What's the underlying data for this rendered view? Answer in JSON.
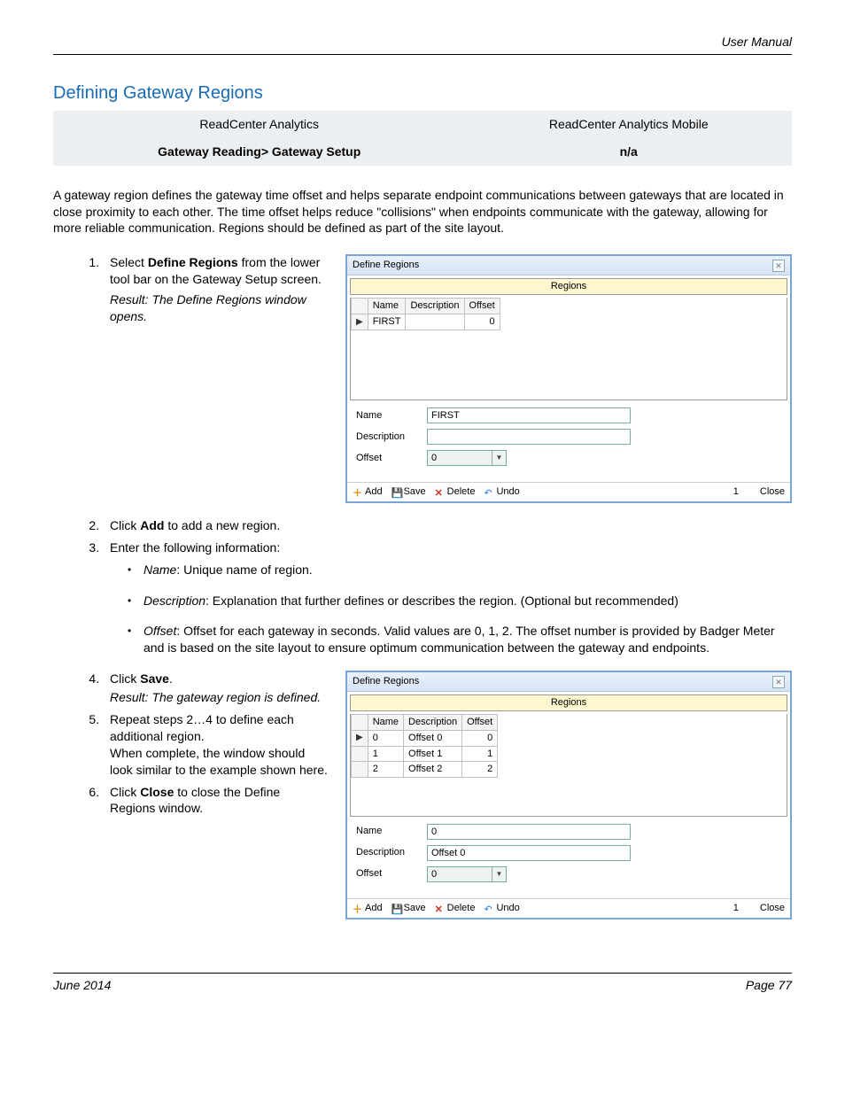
{
  "header": {
    "right": "User Manual"
  },
  "heading": "Defining Gateway Regions",
  "nav": {
    "cols": [
      "ReadCenter Analytics",
      "ReadCenter Analytics Mobile"
    ],
    "vals": [
      "Gateway Reading> Gateway Setup",
      "n/a"
    ]
  },
  "intro": "A gateway region defines the gateway time offset and helps separate endpoint communications between gateways that are located in close proximity to each other. The time offset helps reduce \"collisions\" when endpoints communicate with the gateway, allowing for more reliable communication. Regions should be defined as part of the site layout.",
  "steps": {
    "s1a": "Select ",
    "s1b": "Define Regions",
    "s1c": " from the lower tool bar on the Gateway Setup screen.",
    "s1r": "Result: The Define Regions window opens.",
    "s2a": "Click ",
    "s2b": "Add",
    "s2c": " to add a new region.",
    "s3": "Enter the following information:",
    "b1a": "Name",
    "b1b": ": Unique name of region.",
    "b2a": "Description",
    "b2b": ": Explanation that further defines or describes the region. (Optional but recommended)",
    "b3a": "Offset",
    "b3b": ": Offset for each gateway in seconds. Valid values are 0, 1, 2. The offset number is provided by Badger Meter and is based on the site layout to ensure optimum communication between the gateway and endpoints.",
    "s4a": "Click ",
    "s4b": "Save",
    "s4c": ".",
    "s4r": "Result: The gateway region is defined.",
    "s5a": "Repeat steps 2…4 to define each additional region.",
    "s5b": "When complete, the window should look similar to the example shown here.",
    "s6a": "Click ",
    "s6b": "Close",
    "s6c": " to close the Define Regions window."
  },
  "win": {
    "title": "Define Regions",
    "regions": "Regions",
    "cols": {
      "name": "Name",
      "desc": "Description",
      "off": "Offset"
    },
    "form": {
      "name": "Name",
      "desc": "Description",
      "off": "Offset"
    },
    "toolbar": {
      "add": "Add",
      "save": "Save",
      "del": "Delete",
      "undo": "Undo",
      "close": "Close",
      "count1": "1"
    }
  },
  "win1": {
    "rows": [
      {
        "name": "FIRST",
        "desc": "",
        "off": "0"
      }
    ],
    "name_val": "FIRST",
    "desc_val": "",
    "off_val": "0"
  },
  "win2": {
    "rows": [
      {
        "name": "0",
        "desc": "Offset 0",
        "off": "0"
      },
      {
        "name": "1",
        "desc": "Offset 1",
        "off": "1"
      },
      {
        "name": "2",
        "desc": "Offset 2",
        "off": "2"
      }
    ],
    "name_val": "0",
    "desc_val": "Offset 0",
    "off_val": "0"
  },
  "footer": {
    "left": "June 2014",
    "right": "Page 77"
  }
}
